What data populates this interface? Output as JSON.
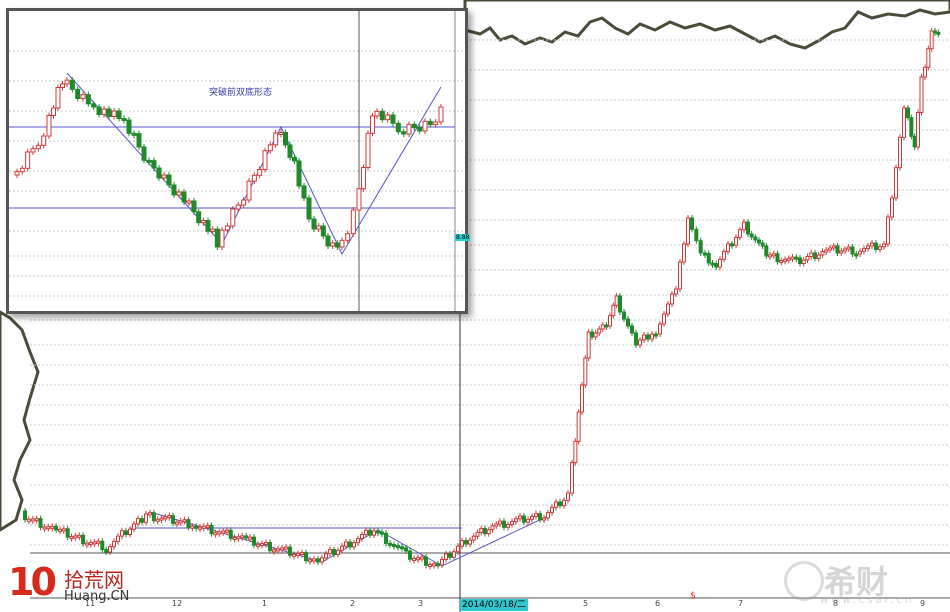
{
  "inset": {
    "title": "突破前双底形态",
    "tag": "8.88"
  },
  "main": {
    "date_tag": "2014/03/18/二",
    "x_ticks": [
      "11",
      "12",
      "1",
      "2",
      "3",
      "5",
      "6",
      "7",
      "8",
      "9"
    ],
    "marker": "$"
  },
  "logo": {
    "number": "10",
    "name_cn": "拾荒网",
    "name_en": "Huang.CN"
  },
  "watermark": {
    "text": "希财",
    "sub": "www.csai.cn"
  },
  "colors": {
    "up": "#d03a3a",
    "down": "#1e8a2a",
    "line": "#5555cc",
    "grid": "#c8c8c8",
    "accent": "#30c8d0"
  }
}
